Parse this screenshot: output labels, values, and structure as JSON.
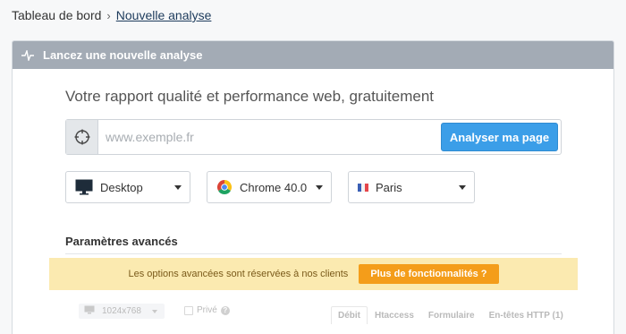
{
  "breadcrumb": {
    "parent": "Tableau de bord",
    "separator": "›",
    "current": "Nouvelle analyse"
  },
  "panel": {
    "title": "Lancez une nouvelle analyse",
    "icon": "pulse-icon"
  },
  "tagline": "Votre rapport qualité et performance web, gratuitement",
  "url_form": {
    "icon": "target-icon",
    "placeholder": "www.exemple.fr",
    "value": "",
    "submit_label": "Analyser ma page"
  },
  "selects": {
    "device": {
      "icon": "monitor-icon",
      "value": "Desktop"
    },
    "browser": {
      "icon": "chrome-icon",
      "value": "Chrome 40.0"
    },
    "location": {
      "icon": "france-flag-icon",
      "value": "Paris"
    }
  },
  "advanced": {
    "title": "Paramètres avancés",
    "promo_text": "Les options avancées sont réservées à nos clients",
    "promo_button": "Plus de fonctionnalités ?",
    "resolution": "1024x768",
    "private_label": "Privé",
    "help_glyph": "?",
    "tabs": [
      {
        "label": "Débit",
        "active": true
      },
      {
        "label": "Htaccess",
        "active": false
      },
      {
        "label": "Formulaire",
        "active": false
      },
      {
        "label": "En-têtes HTTP (1)",
        "active": false
      }
    ]
  },
  "colors": {
    "header_bg": "#a3abb5",
    "primary_button": "#3b9ee8",
    "promo_bg": "#fbeab0",
    "promo_button": "#f49d1a"
  }
}
